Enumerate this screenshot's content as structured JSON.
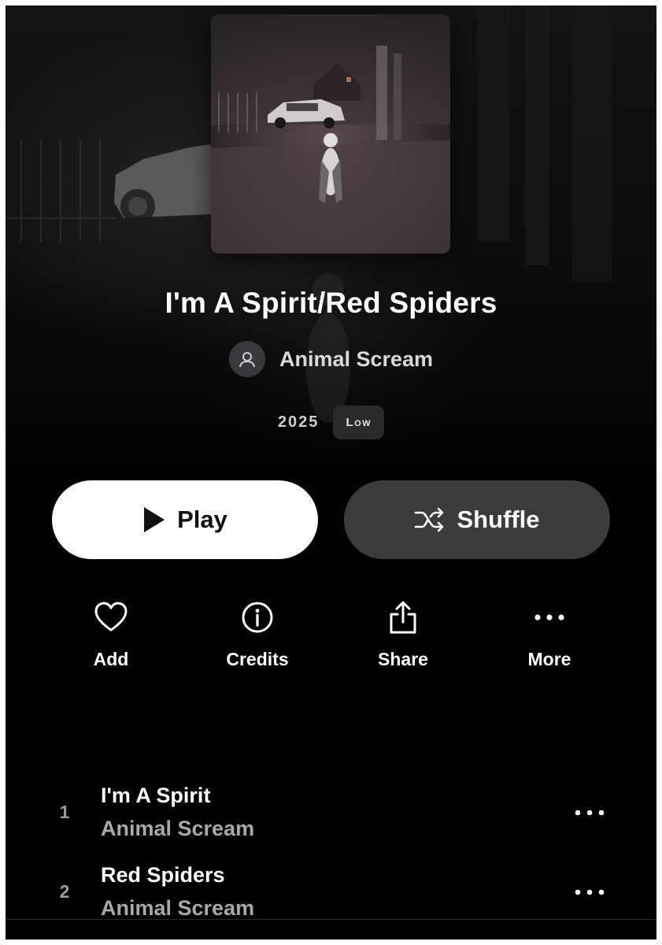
{
  "album": {
    "title": "I'm A Spirit/Red Spiders",
    "artist": "Animal Scream",
    "year": "2025",
    "quality": "Low"
  },
  "buttons": {
    "play_label": "Play",
    "shuffle_label": "Shuffle"
  },
  "actions": [
    {
      "label": "Add",
      "icon": "heart-icon"
    },
    {
      "label": "Credits",
      "icon": "info-icon"
    },
    {
      "label": "Share",
      "icon": "share-icon"
    },
    {
      "label": "More",
      "icon": "more-horizontal-icon"
    }
  ],
  "tracks": [
    {
      "number": "1",
      "title": "I'm A Spirit",
      "artist": "Animal Scream"
    },
    {
      "number": "2",
      "title": "Red Spiders",
      "artist": "Animal Scream"
    }
  ],
  "colors": {
    "background": "#000000",
    "play_button": "#ffffff",
    "shuffle_button": "#3b3b3b",
    "secondary_text": "#a8a8a8"
  }
}
